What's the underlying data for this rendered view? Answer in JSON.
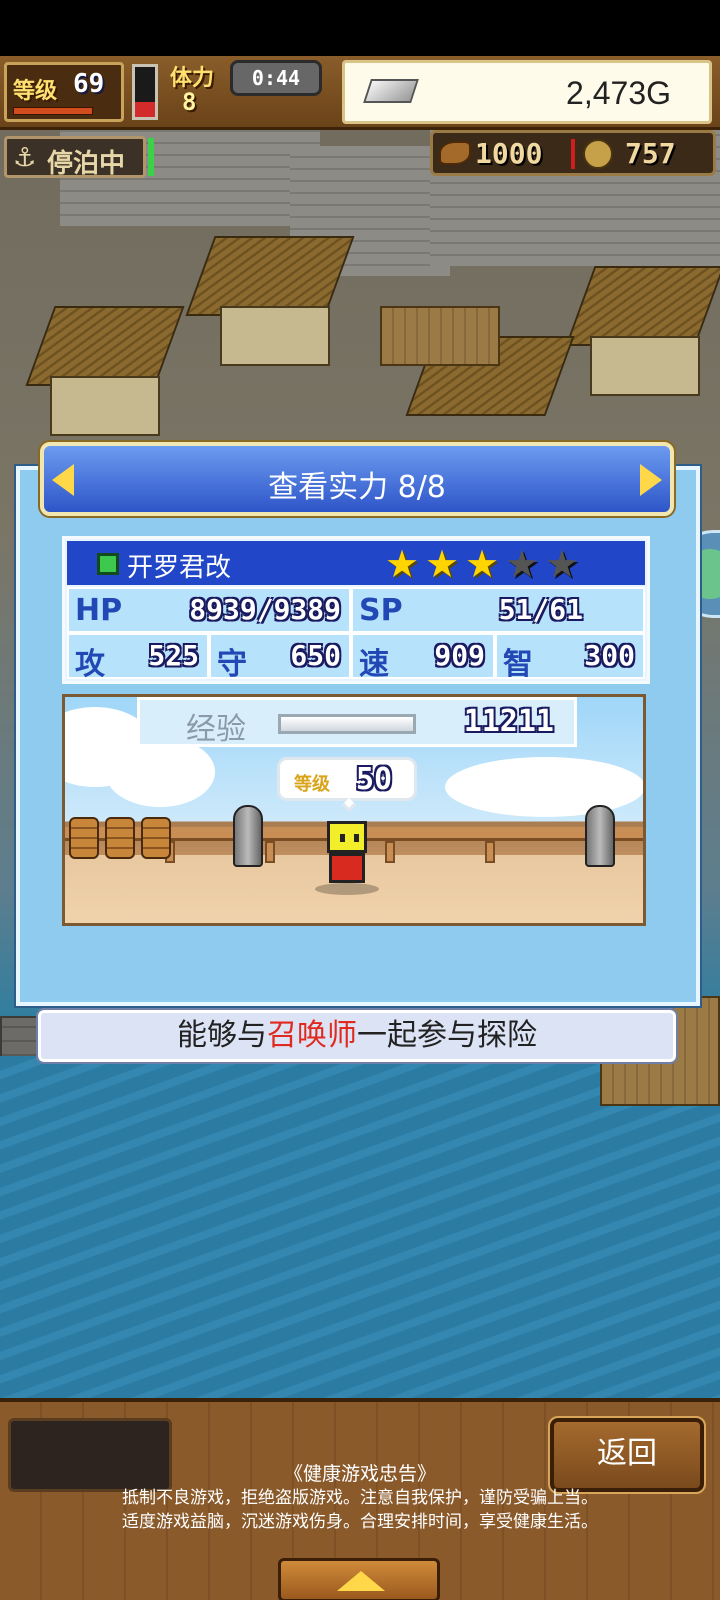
{
  "hud": {
    "level_label": "等级",
    "level_value": "69",
    "level_progress": 0.8,
    "stamina_label": "体力",
    "stamina_value": "8",
    "stamina_fill": 0.3,
    "timer": "0:44",
    "gold": "2,473G",
    "anchor_status": "停泊中",
    "resource_1": "1000",
    "resource_2": "757"
  },
  "dialog": {
    "title": "查看实力 8/8",
    "character": {
      "name": "开罗君改",
      "stars_filled": 3,
      "stars_total": 5
    },
    "stats": {
      "hp_label": "HP",
      "hp_value": "8939/9389",
      "sp_label": "SP",
      "sp_value": "51/61",
      "atk_label": "攻",
      "atk_value": "525",
      "def_label": "守",
      "def_value": "650",
      "spd_label": "速",
      "spd_value": "909",
      "int_label": "智",
      "int_value": "300"
    },
    "exp_label": "经验",
    "exp_value": "11211",
    "exp_progress": 0.0,
    "level_badge_label": "等级",
    "level_badge_value": "50",
    "caption_before": "能够与",
    "caption_highlight": "召唤师",
    "caption_after": "一起参与探险"
  },
  "bottom": {
    "back_label": "返回",
    "notice_title": "《健康游戏忠告》",
    "notice_line1": "抵制不良游戏，拒绝盗版游戏。注意自我保护，谨防受骗上当。",
    "notice_line2": "适度游戏益脑，沉迷游戏伤身。合理安排时间，享受健康生活。"
  },
  "colors": {
    "highlight": "#e02a1f",
    "header_blue": "#2e55c8",
    "star_on": "#ffd400"
  }
}
